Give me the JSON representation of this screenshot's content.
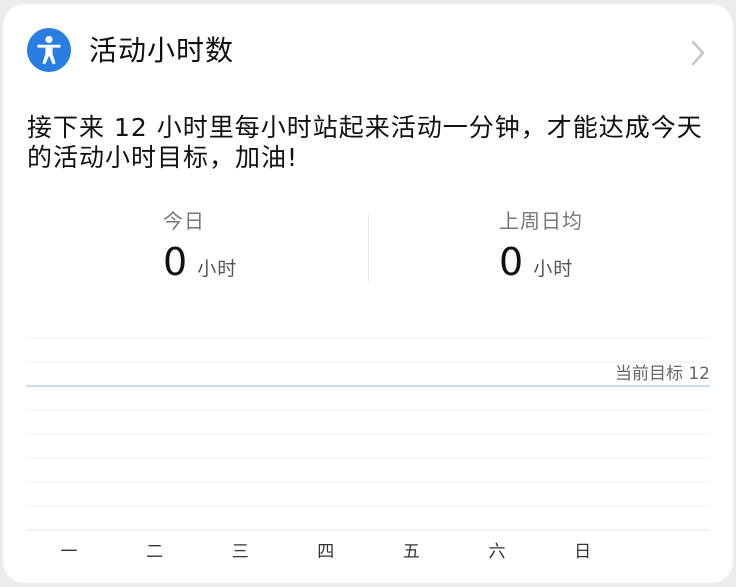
{
  "card": {
    "title": "活动小时数",
    "icon": "accessibility-person-icon",
    "accent_color": "#2a7de1",
    "message": "接下来 12 小时里每小时站起来活动一分钟，才能达成今天的活动小时目标，加油!"
  },
  "stats": {
    "today": {
      "label": "今日",
      "value": "0",
      "unit": "小时"
    },
    "weekly_average": {
      "label": "上周日均",
      "value": "0",
      "unit": "小时"
    }
  },
  "chart_data": {
    "type": "bar",
    "categories": [
      "一",
      "二",
      "三",
      "四",
      "五",
      "六",
      "日"
    ],
    "values": [
      0,
      0,
      0,
      0,
      0,
      0,
      0
    ],
    "goal_label": "当前目标 12",
    "goal_value": 12,
    "ylim": [
      0,
      16
    ],
    "grid": true,
    "goal_line_color": "#a9c6e8"
  }
}
